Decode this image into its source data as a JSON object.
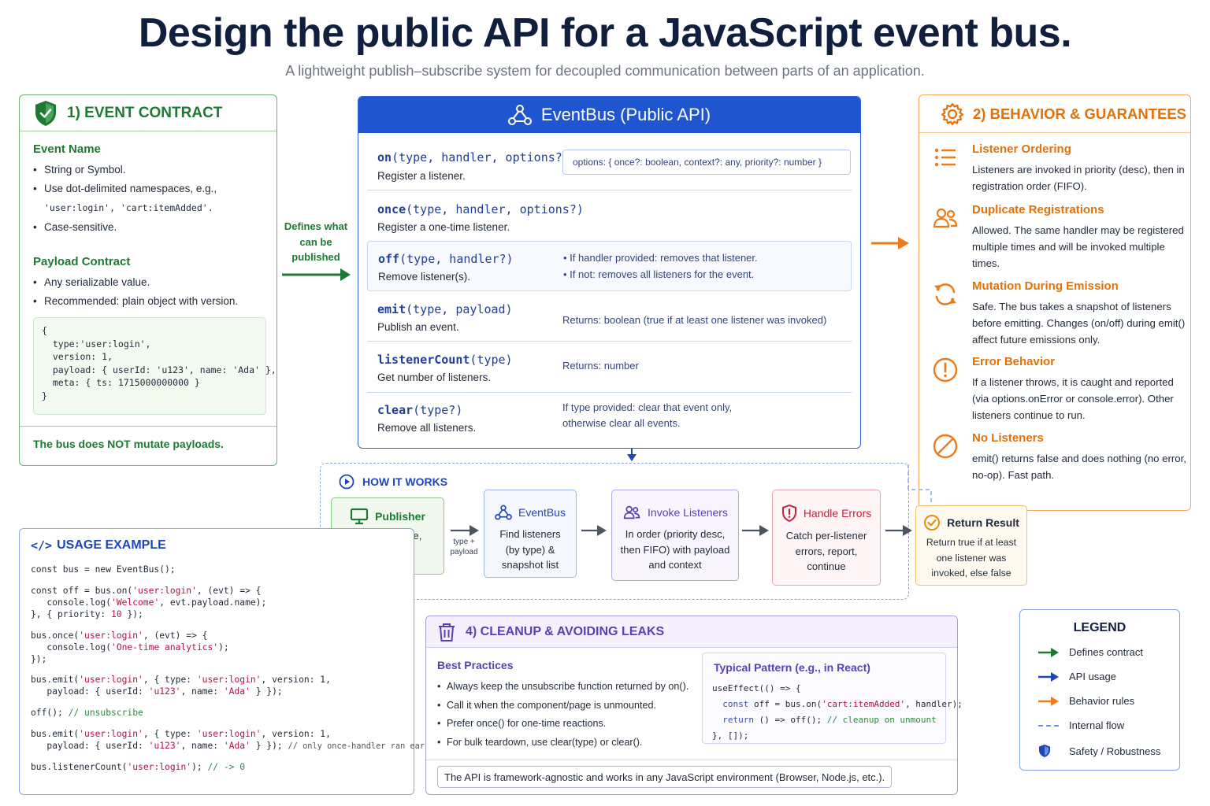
{
  "header": {
    "title": "Design the public API for a JavaScript event bus.",
    "subtitle": "A lightweight publish–subscribe system for decoupled communication between parts of an application."
  },
  "event_contract": {
    "title": "1) EVENT CONTRACT",
    "event_name": {
      "heading": "Event Name",
      "bullets": [
        "String or Symbol.",
        "Use dot-delimited namespaces, e.g.,",
        "Case-sensitive."
      ],
      "examples": "'user:login', 'cart:itemAdded'."
    },
    "payload": {
      "heading": "Payload Contract",
      "bullets": [
        "Any serializable value.",
        "Recommended: plain object with version."
      ],
      "code": "{\n  type:'user:login',\n  version: 1,\n  payload: { userId: 'u123', name: 'Ada' },\n  meta: { ts: 1715000000000 }\n}"
    },
    "footer": "The bus does NOT mutate payloads."
  },
  "defines_arrow_label": "Defines what can be published",
  "api": {
    "title": "EventBus (Public API)",
    "options_note": "options: { once?: boolean, context?: any, priority?: number }",
    "methods": [
      {
        "name": "on",
        "params": "(type, handler, options?)",
        "desc": "Register a listener.",
        "note": ""
      },
      {
        "name": "once",
        "params": "(type, handler, options?)",
        "desc": "Register a one-time listener.",
        "note": ""
      },
      {
        "name": "off",
        "params": "(type, handler?)",
        "desc": "Remove listener(s).",
        "note": "• If handler provided: removes that listener.",
        "note2": "• If not: removes all listeners for the event."
      },
      {
        "name": "emit",
        "params": "(type, payload)",
        "desc": "Publish an event.",
        "note": "Returns: boolean (true if at least one listener was invoked)"
      },
      {
        "name": "listenerCount",
        "params": "(type)",
        "desc": "Get number of listeners.",
        "note": "Returns: number"
      },
      {
        "name": "clear",
        "params": "(type?)",
        "desc": "Remove all listeners.",
        "note": "If type provided: clear that event only,",
        "note2": "otherwise clear all events."
      }
    ]
  },
  "behavior": {
    "title": "2) BEHAVIOR & GUARANTEES",
    "items": [
      {
        "icon": "list-icon",
        "heading": "Listener Ordering",
        "text": "Listeners are invoked in priority (desc), then in registration order (FIFO)."
      },
      {
        "icon": "users-icon",
        "heading": "Duplicate Registrations",
        "text": "Allowed. The same handler may be registered multiple times and will be invoked multiple times."
      },
      {
        "icon": "refresh-icon",
        "heading": "Mutation During Emission",
        "text": "Safe. The bus takes a snapshot of listeners before emitting. Changes (on/off) during emit() affect future emissions only."
      },
      {
        "icon": "alert-icon",
        "heading": "Error Behavior",
        "text": "If a listener throws, it is caught and reported (via options.onError or console.error). Other listeners continue to run."
      },
      {
        "icon": "ban-icon",
        "heading": "No Listeners",
        "text": "emit() returns false and does nothing (no error, no-op). Fast path."
      }
    ]
  },
  "how_it_works": {
    "title": "HOW IT WORKS",
    "arrow_label": "type + payload",
    "steps": [
      {
        "title": "Publisher",
        "text": "calls emit(type, payload)"
      },
      {
        "title": "EventBus",
        "text": "Find listeners (by type) & snapshot list"
      },
      {
        "title": "Invoke Listeners",
        "text": "In order (priority desc, then FIFO) with payload and context"
      },
      {
        "title": "Handle Errors",
        "text": "Catch per-listener errors, report, continue"
      },
      {
        "title": "Return Result",
        "text": "Return true if at least one listener was invoked, else false"
      }
    ]
  },
  "usage": {
    "title": "USAGE EXAMPLE"
  },
  "cleanup": {
    "title": "4) CLEANUP & AVOIDING LEAKS",
    "best_practices_heading": "Best Practices",
    "best_practices": [
      "Always keep the unsubscribe function returned by on().",
      "Call it when the component/page is unmounted.",
      "Prefer once() for one-time reactions.",
      "For bulk teardown, use clear(type) or clear()."
    ],
    "pattern_heading": "Typical Pattern (e.g., in React)",
    "footer": "The API is framework-agnostic and works in any JavaScript environment (Browser, Node.js, etc.)."
  },
  "legend": {
    "title": "LEGEND",
    "items": [
      {
        "label": "Defines contract",
        "color": "#1e7a32"
      },
      {
        "label": "API usage",
        "color": "#1f46b8"
      },
      {
        "label": "Behavior rules",
        "color": "#ee7a1a"
      },
      {
        "label": "Internal flow",
        "color": "#6b8ee0"
      },
      {
        "label": "Safety / Robustness",
        "color": "#1f46b8"
      }
    ]
  }
}
